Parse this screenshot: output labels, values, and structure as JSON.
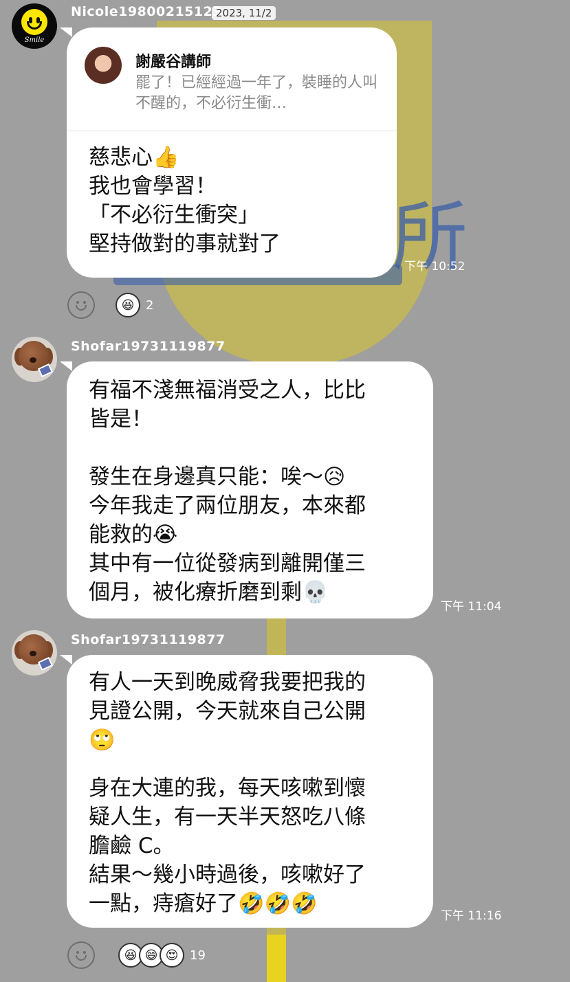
{
  "date_chip": "2023, 11/2",
  "messages": [
    {
      "sender": "Nicole19800215123",
      "avatar_caption": "Smile",
      "quote": {
        "name": "謝嚴谷講師",
        "text": "罷了！已經經過一年了，裝睡的人叫不醒的，不必衍生衝…"
      },
      "lines": [
        "慈悲心👍",
        "我也會學習！",
        "「不必衍生衝突」",
        "堅持做對的事就對了"
      ],
      "time": "下午 10:52",
      "reactions": {
        "faces": [
          "😆"
        ],
        "count": "2"
      }
    },
    {
      "sender": "Shofar19731119877",
      "lines": [
        "有福不淺無福消受之人，比比",
        "皆是！",
        "",
        "發生在身邊真只能：唉～😥",
        "今年我走了兩位朋友，本來都",
        "能救的😭",
        "其中有一位從發病到離開僅三",
        "個月，被化療折磨到剩💀"
      ],
      "time": "下午 11:04"
    },
    {
      "sender": "Shofar19731119877",
      "lines": [
        "有人一天到晚威脅我要把我的",
        "見證公開，今天就來自己公開",
        "🙄",
        "",
        "身在大連的我，每天咳嗽到懷",
        "疑人生，有一天半天怒吃八條",
        "膽鹼 C。",
        "結果～幾小時過後，咳嗽好了",
        "一點，痔瘡好了🤣🤣🤣"
      ],
      "time": "下午 11:16",
      "reactions": {
        "faces": [
          "😆",
          "😄",
          "😍"
        ],
        "count": "19"
      }
    }
  ]
}
